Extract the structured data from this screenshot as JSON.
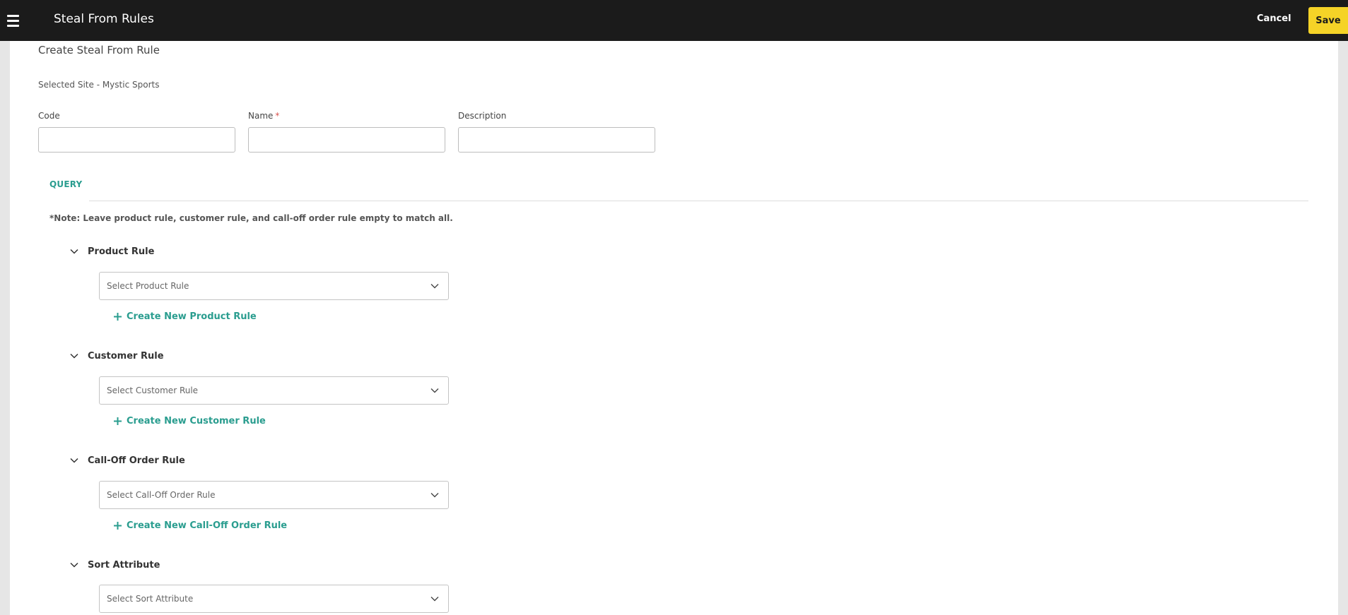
{
  "header": {
    "title": "Steal From Rules",
    "cancel_label": "Cancel",
    "save_label": "Save"
  },
  "form": {
    "page_title": "Create Steal From Rule",
    "selected_site": "Selected Site - Mystic Sports",
    "fields": {
      "code_label": "Code",
      "code_value": "",
      "name_label": "Name",
      "name_required_mark": "*",
      "name_value": "",
      "description_label": "Description",
      "description_value": ""
    }
  },
  "query": {
    "heading": "QUERY",
    "note": "*Note: Leave product rule, customer rule, and call-off order rule empty to match all.",
    "groups": [
      {
        "title": "Product Rule",
        "placeholder": "Select Product Rule",
        "create_label": "Create New Product Rule"
      },
      {
        "title": "Customer Rule",
        "placeholder": "Select Customer Rule",
        "create_label": "Create New Customer Rule"
      },
      {
        "title": "Call-Off Order Rule",
        "placeholder": "Select Call-Off Order Rule",
        "create_label": "Create New Call-Off Order Rule"
      },
      {
        "title": "Sort Attribute",
        "placeholder": "Select Sort Attribute"
      }
    ]
  },
  "icons": {
    "menu": "hamburger-menu-icon",
    "collapse": "chevron-down-icon",
    "dropdown": "chevron-down-icon",
    "add": "plus-icon"
  },
  "colors": {
    "topbar_bg": "#1b1b1b",
    "save_button": "#f5d327",
    "accent_teal": "#2a9d8f",
    "required": "#d9534f"
  }
}
